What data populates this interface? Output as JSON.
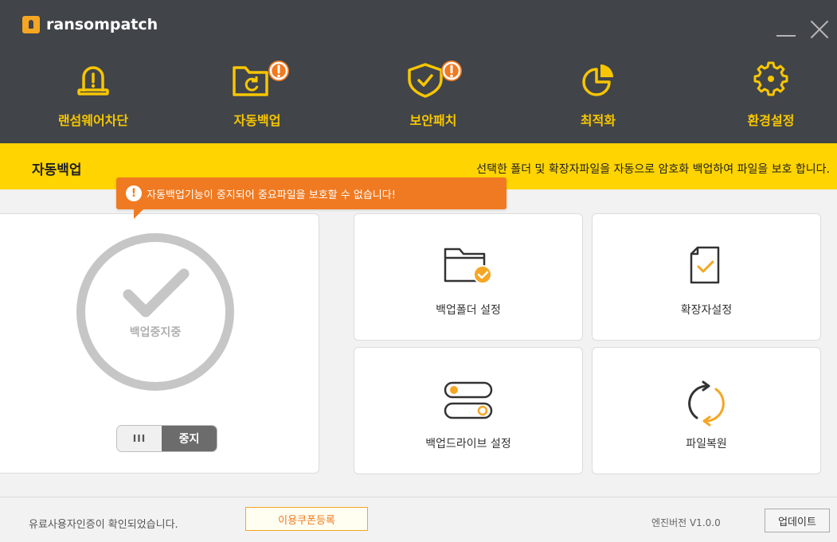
{
  "app": {
    "title": "ransompatch"
  },
  "window": {
    "minimize": "minimize",
    "close": "close"
  },
  "nav": [
    {
      "label": "랜섬웨어차단",
      "icon": "alarm-icon"
    },
    {
      "label": "자동백업",
      "icon": "folder-backup-icon",
      "alert": "!"
    },
    {
      "label": "보안패치",
      "icon": "shield-check-icon",
      "alert": "!"
    },
    {
      "label": "최적화",
      "icon": "pie-chart-icon"
    },
    {
      "label": "환경설정",
      "icon": "gear-icon"
    }
  ],
  "banner": {
    "title": "자동백업",
    "description": "선택한 폴더 및 확장자파일을 자동으로 암호화 백업하여 파일을 보호 합니다."
  },
  "tooltip": {
    "icon": "!",
    "text": "자동백업기능이 중지되어 중요파일을 보호할 수 없습니다!"
  },
  "status": {
    "label": "백업중지중",
    "toggle_knob": "III",
    "toggle_state": "중지"
  },
  "features": [
    {
      "label": "백업폴더 설정",
      "icon": "folder-check-icon"
    },
    {
      "label": "확장자설정",
      "icon": "document-check-icon"
    },
    {
      "label": "백업드라이브 설정",
      "icon": "drive-toggle-icon"
    },
    {
      "label": "파일복원",
      "icon": "restore-icon"
    }
  ],
  "footer": {
    "license_text": "유료사용자인증이 확인되었습니다.",
    "coupon_button": "이용쿠폰등록",
    "version": "엔진버전 V1.0.0",
    "update_button": "업데이트"
  },
  "colors": {
    "header": "#414449",
    "accent_yellow": "#ffd400",
    "alert_orange": "#f07a21"
  }
}
